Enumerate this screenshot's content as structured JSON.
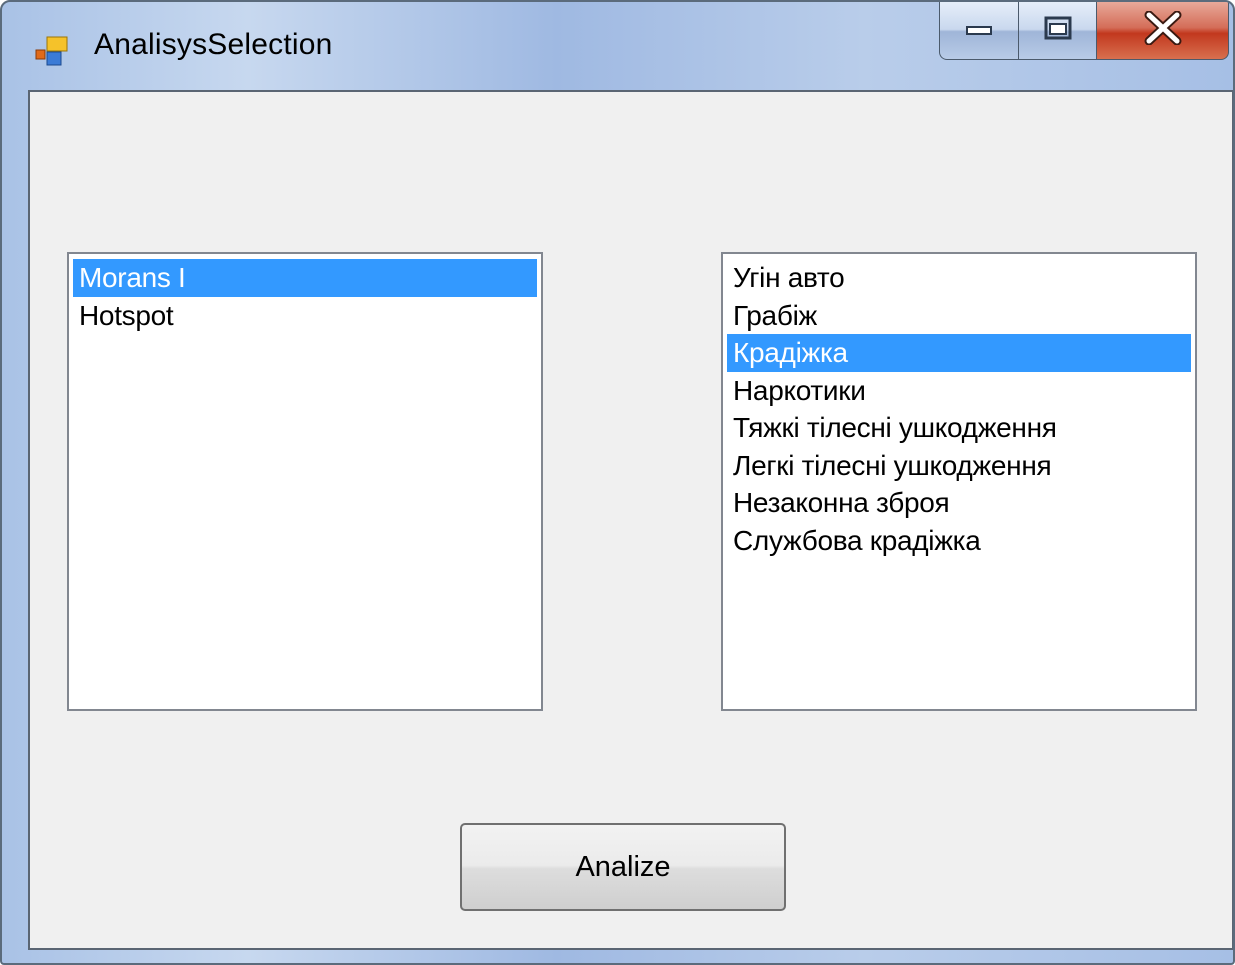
{
  "window": {
    "title": "AnalisysSelection",
    "controls": {
      "minimize_icon": "minimize-icon",
      "maximize_icon": "maximize-icon",
      "close_icon": "close-icon"
    }
  },
  "analysis_list": {
    "items": [
      {
        "label": "Morans I",
        "selected": true
      },
      {
        "label": "Hotspot",
        "selected": false
      }
    ]
  },
  "crime_list": {
    "items": [
      {
        "label": "Угін авто",
        "selected": false
      },
      {
        "label": "Грабіж",
        "selected": false
      },
      {
        "label": "Крадіжка",
        "selected": true
      },
      {
        "label": "Наркотики",
        "selected": false
      },
      {
        "label": "Тяжкі тілесні ушкодження",
        "selected": false
      },
      {
        "label": "Легкі тілесні ушкодження",
        "selected": false
      },
      {
        "label": "Незаконна зброя",
        "selected": false
      },
      {
        "label": "Службова крадіжка",
        "selected": false
      }
    ]
  },
  "analyze_button": {
    "label": "Analize"
  },
  "colors": {
    "selection": "#3399ff",
    "client_background": "#f0f0f0",
    "close_button": "#c2381e"
  }
}
